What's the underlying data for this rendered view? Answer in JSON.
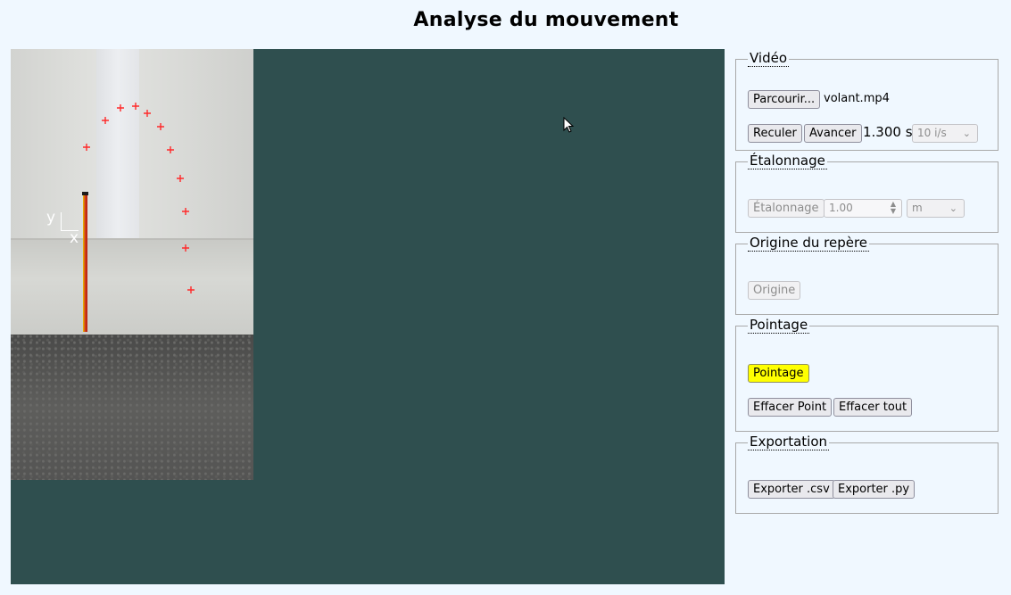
{
  "page": {
    "title": "Analyse du mouvement"
  },
  "video": {
    "axis_y": "y",
    "axis_x": "x",
    "points_count": 11
  },
  "controls": {
    "video": {
      "legend": "Vidéo",
      "browse_label": "Parcourir...",
      "filename": "volant.mp4",
      "back_label": "Reculer",
      "forward_label": "Avancer",
      "time": "1.300 s",
      "rate": "10 i/s"
    },
    "calibration": {
      "legend": "Étalonnage",
      "button_label": "Étalonnage",
      "value": "1.00",
      "unit": "m"
    },
    "origin": {
      "legend": "Origine du repère",
      "button_label": "Origine"
    },
    "pointing": {
      "legend": "Pointage",
      "button_label": "Pointage",
      "clear_point_label": "Effacer Point",
      "clear_all_label": "Effacer tout"
    },
    "export": {
      "legend": "Exportation",
      "csv_label": "Exporter .csv",
      "py_label": "Exporter .py"
    }
  },
  "colors": {
    "canvas_bg": "#2f4f4f",
    "page_bg": "#f0f8ff",
    "marker": "#ff2a2a",
    "pointage_active": "#ffff00"
  }
}
